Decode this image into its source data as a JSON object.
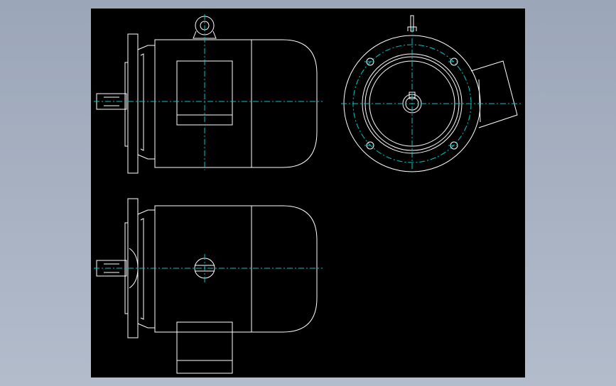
{
  "window": {
    "background": "#a7b1c2"
  },
  "drawing": {
    "background_color": "#000000",
    "line_color": "#ffffff",
    "centerline_color": "#00c8c8",
    "views": [
      "side-view-top",
      "end-view",
      "side-view-bottom"
    ]
  }
}
